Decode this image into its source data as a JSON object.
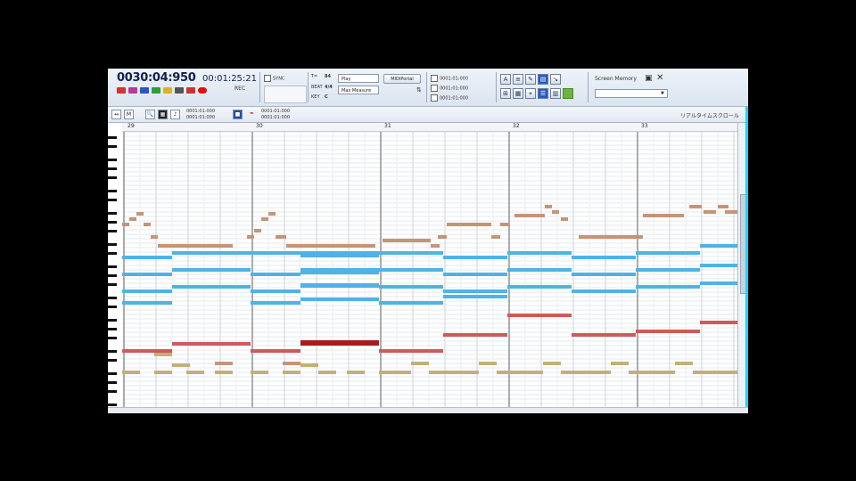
{
  "toolbar": {
    "position": "0030:04:950",
    "time": "00:01:25:21",
    "rec_label": "REC",
    "tempo_labels": [
      "T=",
      "BEAT",
      "KEY"
    ],
    "tempo_values": [
      "84",
      "4/4",
      "C"
    ],
    "play_mode": "Play",
    "measure_mode": "Max Measure",
    "midi_button": "MIDIPortal",
    "sync_label": "SYNC",
    "slots": [
      "0001:01:000",
      "0001:01:000",
      "0001:01:000"
    ],
    "screen_memory_label": "Screen Memory"
  },
  "toolbar2": {
    "range_start": "0001:01:000",
    "range_end": "0001:01:000",
    "range_start2": "0001:01:000",
    "range_end2": "0001:01:000",
    "scroll_label": "リアルタイムスクロール"
  },
  "ruler": {
    "measures": [
      "29",
      "30",
      "31",
      "32",
      "33"
    ]
  },
  "colors": {
    "bass": "#c69476",
    "strings": "#4db4e6",
    "piano": "#cf5a5a",
    "pad": "#c2b07a"
  },
  "notes": {
    "bass": [
      {
        "b": 0,
        "s": 0,
        "w": 2,
        "n": 41
      },
      {
        "b": 2,
        "s": 0,
        "w": 2,
        "n": 44
      },
      {
        "b": 4,
        "s": 0,
        "w": 2,
        "n": 43
      },
      {
        "b": 6,
        "s": 0,
        "w": 2,
        "n": 41
      },
      {
        "b": 8,
        "s": 0,
        "w": 2,
        "n": 38
      }
    ]
  }
}
